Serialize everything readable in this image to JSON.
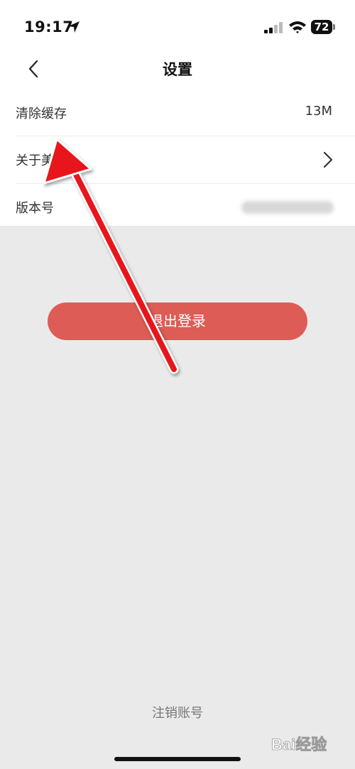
{
  "status_bar": {
    "time": "19:17",
    "battery": "72"
  },
  "nav": {
    "title": "设置"
  },
  "rows": {
    "clear_cache": {
      "label": "清除缓存",
      "value": "13M"
    },
    "about": {
      "label": "关于美"
    },
    "version": {
      "label": "版本号"
    }
  },
  "logout": {
    "label": "退出登录"
  },
  "deregister": {
    "label": "注销账号"
  },
  "watermark": {
    "text": "Bai经验"
  },
  "colors": {
    "accent": "#dd5c55",
    "background": "#ebeaeb",
    "arrow": "#e8141b"
  }
}
